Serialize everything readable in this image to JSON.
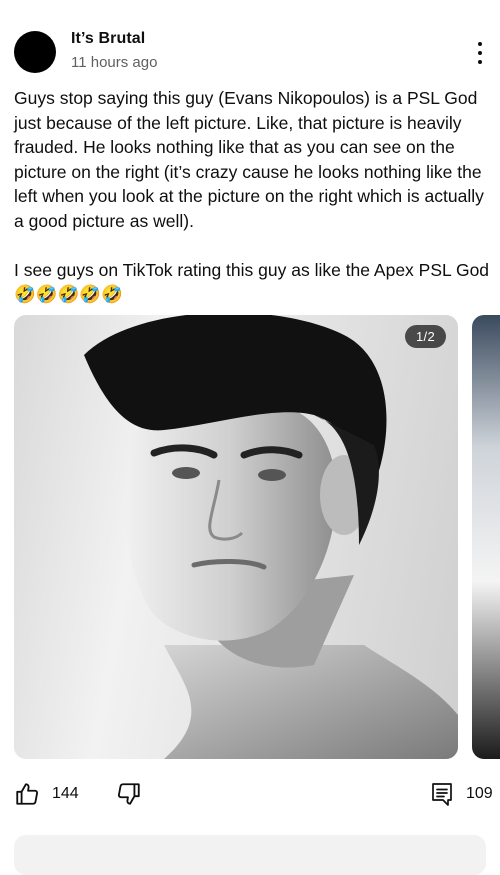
{
  "post": {
    "author": "It’s Brutal",
    "time": "11 hours ago",
    "paragraphs": [
      "Guys stop saying this guy (Evans Nikopoulos) is a PSL God just because of the left picture. Like, that picture is heavily frauded. He looks nothing like that as you can see on the picture on the right (it’s crazy cause he looks nothing like the left when you look at the picture on the right which is actually a good picture as well).",
      "I see guys on TikTok rating this guy as like the Apex PSL God🤣🤣🤣🤣🤣"
    ],
    "image_counter": "1/2"
  },
  "actions": {
    "likes": "144",
    "comments": "109"
  },
  "icons": {
    "menu": "more-vertical-icon",
    "like": "thumbs-up-icon",
    "dislike": "thumbs-down-icon",
    "comments": "comment-icon"
  },
  "colors": {
    "text": "#0f0f0f",
    "secondary_text": "#606060",
    "avatar": "#000000",
    "counter_bg": "#282828"
  }
}
